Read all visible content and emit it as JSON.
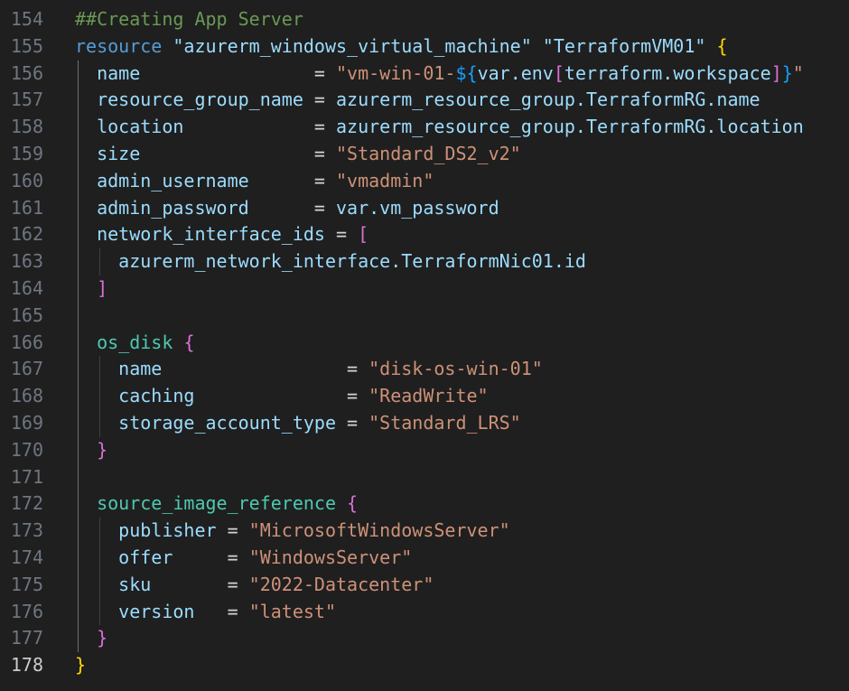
{
  "editor": {
    "language": "terraform",
    "active_line": "178",
    "lines": [
      {
        "n": "154",
        "tokens": [
          {
            "t": "##Creating App Server",
            "c": "comment"
          }
        ]
      },
      {
        "n": "155",
        "tokens": [
          {
            "t": "resource",
            "c": "kw"
          },
          {
            "t": " ",
            "c": "plain"
          },
          {
            "t": "\"azurerm_windows_virtual_machine\"",
            "c": "str2"
          },
          {
            "t": " ",
            "c": "plain"
          },
          {
            "t": "\"TerraformVM01\"",
            "c": "str2"
          },
          {
            "t": " ",
            "c": "plain"
          },
          {
            "t": "{",
            "c": "b1"
          }
        ]
      },
      {
        "n": "156",
        "tokens": [
          {
            "t": "  ",
            "c": "plain"
          },
          {
            "t": "name",
            "c": "attr"
          },
          {
            "t": "                = ",
            "c": "op"
          },
          {
            "t": "\"vm-win-01-",
            "c": "str"
          },
          {
            "t": "${",
            "c": "b3"
          },
          {
            "t": "var",
            "c": "attr"
          },
          {
            "t": ".env",
            "c": "attr"
          },
          {
            "t": "[",
            "c": "b2"
          },
          {
            "t": "terraform.workspace",
            "c": "attr"
          },
          {
            "t": "]",
            "c": "b2"
          },
          {
            "t": "}",
            "c": "b3"
          },
          {
            "t": "\"",
            "c": "str"
          }
        ]
      },
      {
        "n": "157",
        "tokens": [
          {
            "t": "  ",
            "c": "plain"
          },
          {
            "t": "resource_group_name",
            "c": "attr"
          },
          {
            "t": " = ",
            "c": "op"
          },
          {
            "t": "azurerm_resource_group.TerraformRG.name",
            "c": "attr"
          }
        ]
      },
      {
        "n": "158",
        "tokens": [
          {
            "t": "  ",
            "c": "plain"
          },
          {
            "t": "location",
            "c": "attr"
          },
          {
            "t": "            = ",
            "c": "op"
          },
          {
            "t": "azurerm_resource_group.TerraformRG.location",
            "c": "attr"
          }
        ]
      },
      {
        "n": "159",
        "tokens": [
          {
            "t": "  ",
            "c": "plain"
          },
          {
            "t": "size",
            "c": "attr"
          },
          {
            "t": "                = ",
            "c": "op"
          },
          {
            "t": "\"Standard_DS2_v2\"",
            "c": "str"
          }
        ]
      },
      {
        "n": "160",
        "tokens": [
          {
            "t": "  ",
            "c": "plain"
          },
          {
            "t": "admin_username",
            "c": "attr"
          },
          {
            "t": "      = ",
            "c": "op"
          },
          {
            "t": "\"vmadmin\"",
            "c": "str"
          }
        ]
      },
      {
        "n": "161",
        "tokens": [
          {
            "t": "  ",
            "c": "plain"
          },
          {
            "t": "admin_password",
            "c": "attr"
          },
          {
            "t": "      = ",
            "c": "op"
          },
          {
            "t": "var.vm_password",
            "c": "attr"
          }
        ]
      },
      {
        "n": "162",
        "tokens": [
          {
            "t": "  ",
            "c": "plain"
          },
          {
            "t": "network_interface_ids",
            "c": "attr"
          },
          {
            "t": " = ",
            "c": "op"
          },
          {
            "t": "[",
            "c": "b2"
          }
        ]
      },
      {
        "n": "163",
        "tokens": [
          {
            "t": "    ",
            "c": "plain"
          },
          {
            "t": "azurerm_network_interface.TerraformNic01.id",
            "c": "attr"
          }
        ]
      },
      {
        "n": "164",
        "tokens": [
          {
            "t": "  ",
            "c": "plain"
          },
          {
            "t": "]",
            "c": "b2"
          }
        ]
      },
      {
        "n": "165",
        "tokens": []
      },
      {
        "n": "166",
        "tokens": [
          {
            "t": "  ",
            "c": "plain"
          },
          {
            "t": "os_disk",
            "c": "attr2"
          },
          {
            "t": " ",
            "c": "plain"
          },
          {
            "t": "{",
            "c": "b2"
          }
        ]
      },
      {
        "n": "167",
        "tokens": [
          {
            "t": "    ",
            "c": "plain"
          },
          {
            "t": "name",
            "c": "attr"
          },
          {
            "t": "                 = ",
            "c": "op"
          },
          {
            "t": "\"disk-os-win-01\"",
            "c": "str"
          }
        ]
      },
      {
        "n": "168",
        "tokens": [
          {
            "t": "    ",
            "c": "plain"
          },
          {
            "t": "caching",
            "c": "attr"
          },
          {
            "t": "              = ",
            "c": "op"
          },
          {
            "t": "\"ReadWrite\"",
            "c": "str"
          }
        ]
      },
      {
        "n": "169",
        "tokens": [
          {
            "t": "    ",
            "c": "plain"
          },
          {
            "t": "storage_account_type",
            "c": "attr"
          },
          {
            "t": " = ",
            "c": "op"
          },
          {
            "t": "\"Standard_LRS\"",
            "c": "str"
          }
        ]
      },
      {
        "n": "170",
        "tokens": [
          {
            "t": "  ",
            "c": "plain"
          },
          {
            "t": "}",
            "c": "b2"
          }
        ]
      },
      {
        "n": "171",
        "tokens": []
      },
      {
        "n": "172",
        "tokens": [
          {
            "t": "  ",
            "c": "plain"
          },
          {
            "t": "source_image_reference",
            "c": "attr2"
          },
          {
            "t": " ",
            "c": "plain"
          },
          {
            "t": "{",
            "c": "b2"
          }
        ]
      },
      {
        "n": "173",
        "tokens": [
          {
            "t": "    ",
            "c": "plain"
          },
          {
            "t": "publisher",
            "c": "attr"
          },
          {
            "t": " = ",
            "c": "op"
          },
          {
            "t": "\"MicrosoftWindowsServer\"",
            "c": "str"
          }
        ]
      },
      {
        "n": "174",
        "tokens": [
          {
            "t": "    ",
            "c": "plain"
          },
          {
            "t": "offer",
            "c": "attr"
          },
          {
            "t": "     = ",
            "c": "op"
          },
          {
            "t": "\"WindowsServer\"",
            "c": "str"
          }
        ]
      },
      {
        "n": "175",
        "tokens": [
          {
            "t": "    ",
            "c": "plain"
          },
          {
            "t": "sku",
            "c": "attr"
          },
          {
            "t": "       = ",
            "c": "op"
          },
          {
            "t": "\"2022-Datacenter\"",
            "c": "str"
          }
        ]
      },
      {
        "n": "176",
        "tokens": [
          {
            "t": "    ",
            "c": "plain"
          },
          {
            "t": "version",
            "c": "attr"
          },
          {
            "t": "   = ",
            "c": "op"
          },
          {
            "t": "\"latest\"",
            "c": "str"
          }
        ]
      },
      {
        "n": "177",
        "tokens": [
          {
            "t": "  ",
            "c": "plain"
          },
          {
            "t": "}",
            "c": "b2"
          }
        ]
      },
      {
        "n": "178",
        "tokens": [
          {
            "t": "}",
            "c": "b1"
          }
        ]
      }
    ]
  },
  "colors": {
    "background": "#1f1f1f",
    "line_number": "#6e7681",
    "line_number_active": "#cccccc",
    "comment": "#6a9955",
    "keyword": "#569cd6",
    "attribute": "#9cdcfe",
    "block_name": "#4ec9b0",
    "string": "#ce9178",
    "string_label": "#9cdcfe",
    "bracket_level1": "#ffd700",
    "bracket_level2": "#da70d6",
    "bracket_level3": "#179fff"
  }
}
